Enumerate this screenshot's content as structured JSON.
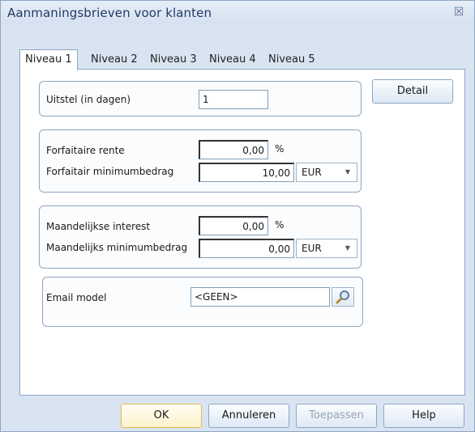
{
  "window": {
    "title": "Aanmaningsbrieven voor klanten",
    "close_glyph": "☒"
  },
  "tabs": [
    {
      "label": "Niveau 1",
      "active": true
    },
    {
      "label": "Niveau 2",
      "active": false
    },
    {
      "label": "Niveau 3",
      "active": false
    },
    {
      "label": "Niveau 4",
      "active": false
    },
    {
      "label": "Niveau 5",
      "active": false
    }
  ],
  "delay": {
    "label": "Uitstel (in dagen)",
    "value": "1"
  },
  "detail_button": "Detail",
  "fixed_interest": {
    "rate_label": "Forfaitaire rente",
    "rate_value": "0,00",
    "rate_unit": "%",
    "min_label": "Forfaitair minimumbedrag",
    "min_value": "10,00",
    "currency": "EUR"
  },
  "monthly_interest": {
    "rate_label": "Maandelijkse interest",
    "rate_value": "0,00",
    "rate_unit": "%",
    "min_label": "Maandelijks minimumbedrag",
    "min_value": "0,00",
    "currency": "EUR"
  },
  "email": {
    "label": "Email model",
    "value": "<GEEN>",
    "lookup_icon": "magnifier-icon"
  },
  "footer": {
    "ok": "OK",
    "cancel": "Annuleren",
    "apply": "Toepassen",
    "help": "Help"
  },
  "colors": {
    "window_bg": "#d9e4f2",
    "border": "#8fa5c2",
    "default_button_border": "#e3b94a",
    "disabled_text": "#9aa4b0"
  }
}
